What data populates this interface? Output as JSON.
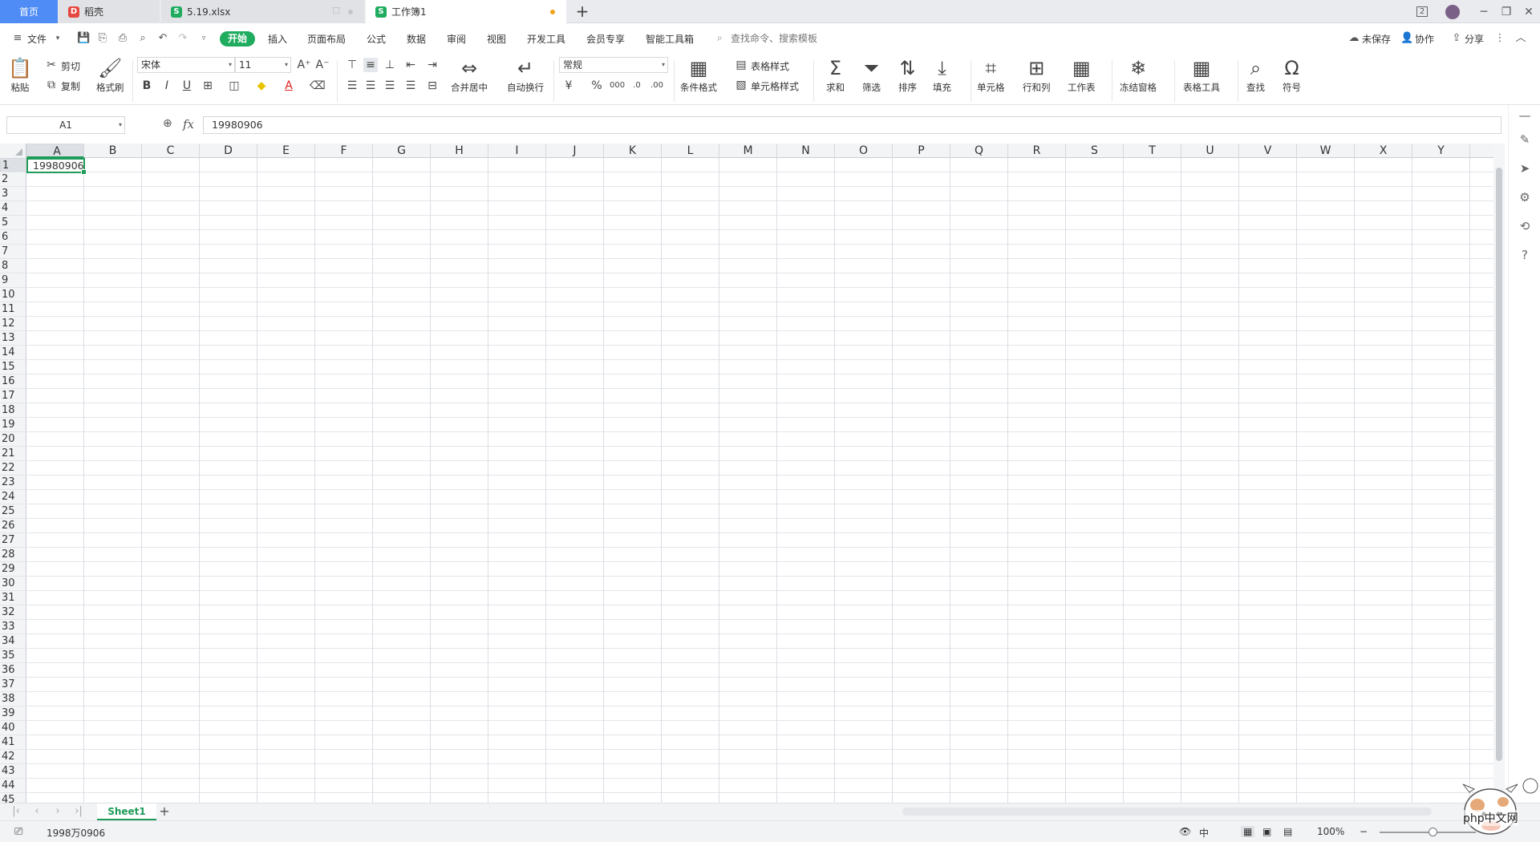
{
  "tabs": {
    "home": "首页",
    "docer": "稻壳",
    "file": "5.19.xlsx",
    "active": "工作簿1",
    "add": "+"
  },
  "window": {
    "badge": "2"
  },
  "menu": {
    "file": "文件",
    "items": [
      "开始",
      "插入",
      "页面布局",
      "公式",
      "数据",
      "审阅",
      "视图",
      "开发工具",
      "会员专享",
      "智能工具箱"
    ],
    "search_placeholder": "查找命令、搜索模板",
    "unsaved": "未保存",
    "collab": "协作",
    "share": "分享"
  },
  "ribbon": {
    "paste": "粘贴",
    "cut": "剪切",
    "copy": "复制",
    "format_painter": "格式刷",
    "font_name": "宋体",
    "font_size": "11",
    "merge_center": "合并居中",
    "wrap_text": "自动换行",
    "number_format": "常规",
    "conditional_format": "条件格式",
    "table_style": "表格样式",
    "cell_style": "单元格样式",
    "sum": "求和",
    "filter": "筛选",
    "sort": "排序",
    "fill": "填充",
    "cell": "单元格",
    "row_col": "行和列",
    "worksheet": "工作表",
    "freeze": "冻结窗格",
    "table_tools": "表格工具",
    "find": "查找",
    "symbol": "符号"
  },
  "formula_bar": {
    "name_box": "A1",
    "fx": "fx",
    "value": "19980906"
  },
  "grid": {
    "columns": [
      "A",
      "B",
      "C",
      "D",
      "E",
      "F",
      "G",
      "H",
      "I",
      "J",
      "K",
      "L",
      "M",
      "N",
      "O",
      "P",
      "Q",
      "R",
      "S",
      "T",
      "U",
      "V",
      "W",
      "X",
      "Y"
    ],
    "row_count": 45,
    "cell_a1": "19980906"
  },
  "sheets": {
    "names": [
      "Sheet1"
    ],
    "add": "+"
  },
  "status": {
    "display_value": "1998万0906",
    "zoom": "100%",
    "input_mode": "中"
  },
  "watermark": {
    "text": "php中文网"
  },
  "colors": {
    "accent": "#1fac5f",
    "selection": "#1e9b58",
    "home_tab": "#4f8cf6"
  }
}
